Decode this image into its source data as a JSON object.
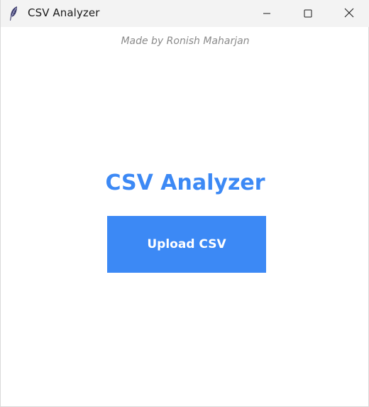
{
  "window": {
    "title": "CSV Analyzer",
    "icon": "feather-icon",
    "controls": {
      "minimize": "minimize-icon",
      "maximize": "maximize-icon",
      "close": "close-icon"
    }
  },
  "main": {
    "credit": "Made by Ronish Maharjan",
    "heading": "CSV Analyzer",
    "upload_label": "Upload CSV"
  },
  "colors": {
    "accent": "#3c89f5",
    "credit_text": "#8a8a8a",
    "titlebar_bg": "#f3f3f3"
  }
}
